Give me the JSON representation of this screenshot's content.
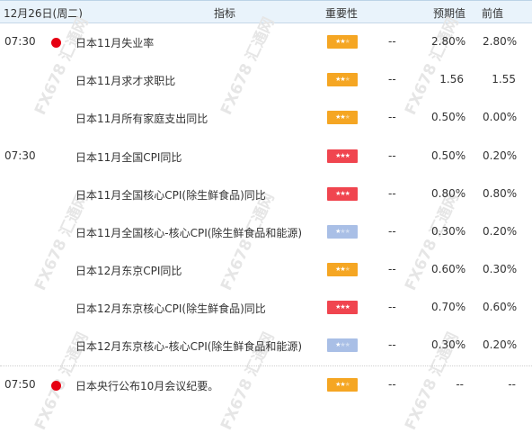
{
  "header": {
    "date": "12月26日(周二)",
    "indicator": "指标",
    "importance": "重要性",
    "forecast": "预期值",
    "previous": "前值"
  },
  "watermark": "FX678 汇通网",
  "events": [
    {
      "time": "07:30",
      "flag": "japan-flag-icon",
      "name": "日本11月失业率",
      "importance": 2,
      "actual": "--",
      "forecast": "2.80%",
      "previous": "2.80%"
    },
    {
      "time": "",
      "flag": "",
      "name": "日本11月求才求职比",
      "importance": 2,
      "actual": "--",
      "forecast": "1.56",
      "previous": "1.55"
    },
    {
      "time": "",
      "flag": "",
      "name": "日本11月所有家庭支出同比",
      "importance": 2,
      "actual": "--",
      "forecast": "0.50%",
      "previous": "0.00%"
    },
    {
      "time": "07:30",
      "flag": "",
      "name": "日本11月全国CPI同比",
      "importance": 3,
      "actual": "--",
      "forecast": "0.50%",
      "previous": "0.20%"
    },
    {
      "time": "",
      "flag": "",
      "name": "日本11月全国核心CPI(除生鲜食品)同比",
      "importance": 3,
      "actual": "--",
      "forecast": "0.80%",
      "previous": "0.80%"
    },
    {
      "time": "",
      "flag": "",
      "name": "日本11月全国核心-核心CPI(除生鲜食品和能源)",
      "importance": 1,
      "actual": "--",
      "forecast": "0.30%",
      "previous": "0.20%"
    },
    {
      "time": "",
      "flag": "",
      "name": "日本12月东京CPI同比",
      "importance": 2,
      "actual": "--",
      "forecast": "0.60%",
      "previous": "0.30%"
    },
    {
      "time": "",
      "flag": "",
      "name": "日本12月东京核心CPI(除生鲜食品)同比",
      "importance": 3,
      "actual": "--",
      "forecast": "0.70%",
      "previous": "0.60%"
    },
    {
      "time": "",
      "flag": "",
      "name": "日本12月东京核心-核心CPI(除生鲜食品和能源)",
      "importance": 1,
      "actual": "--",
      "forecast": "0.30%",
      "previous": "0.20%"
    },
    {
      "time": "07:50",
      "flag": "japan-flag-icon",
      "name": "日本央行公布10月会议纪要。",
      "importance": 2,
      "actual": "--",
      "forecast": "--",
      "previous": "--"
    }
  ],
  "colors": {
    "importance_low": "#f5a623",
    "importance_high": "#f0454f",
    "importance_mid": "#a9bfe6",
    "japan_flag": "#e60012",
    "header_bg": "#e9f3fb"
  }
}
